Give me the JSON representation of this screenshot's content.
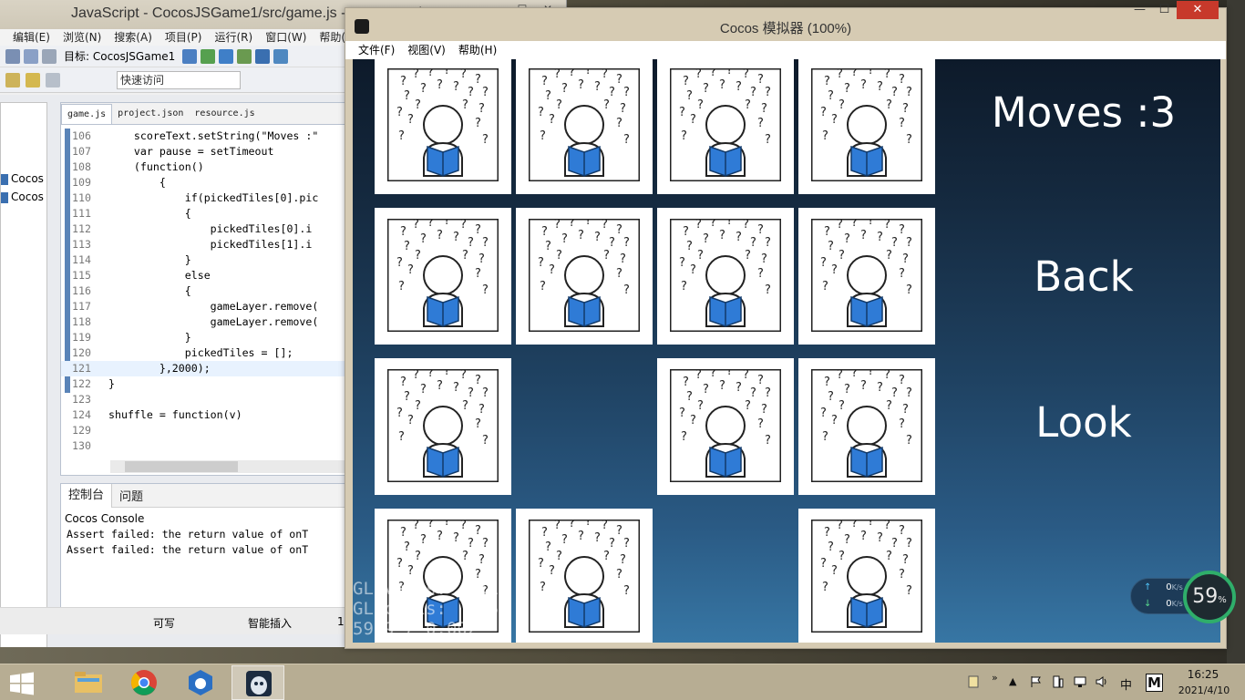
{
  "ide": {
    "title": "JavaScript - CocosJSGame1/src/game.js - Cocos Code IDE",
    "window_buttons": [
      "—",
      "☐",
      "✕"
    ],
    "menu": [
      "编辑(E)",
      "浏览(N)",
      "搜索(A)",
      "项目(P)",
      "运行(R)",
      "窗口(W)",
      "帮助(H)"
    ],
    "target_label": "目标: CocosJSGame1",
    "quick_access_placeholder": "快速访问",
    "explorer_items": [
      "Cocos",
      "Cocos"
    ],
    "editor_tabs": [
      "game.js",
      "project.json",
      "resource.js"
    ],
    "code_lines": [
      {
        "num": "106",
        "text": "    scoreText.setString(\"Moves :\""
      },
      {
        "num": "107",
        "text": "    var pause = setTimeout"
      },
      {
        "num": "108",
        "text": "    (function()"
      },
      {
        "num": "109",
        "text": "        {"
      },
      {
        "num": "110",
        "text": "            if(pickedTiles[0].pic"
      },
      {
        "num": "111",
        "text": "            {"
      },
      {
        "num": "112",
        "text": "                pickedTiles[0].i"
      },
      {
        "num": "113",
        "text": "                pickedTiles[1].i"
      },
      {
        "num": "114",
        "text": "            }"
      },
      {
        "num": "115",
        "text": "            else"
      },
      {
        "num": "116",
        "text": "            {"
      },
      {
        "num": "117",
        "text": "                gameLayer.remove("
      },
      {
        "num": "118",
        "text": "                gameLayer.remove("
      },
      {
        "num": "119",
        "text": "            }"
      },
      {
        "num": "120",
        "text": "            pickedTiles = [];"
      },
      {
        "num": "121",
        "text": "        },2000);"
      },
      {
        "num": "122",
        "text": "}"
      },
      {
        "num": "123",
        "text": ""
      },
      {
        "num": "124",
        "text": "shuffle = function(v)"
      },
      {
        "num": "129",
        "text": ""
      },
      {
        "num": "130",
        "text": ""
      }
    ],
    "console_tabs": [
      "控制台",
      "问题"
    ],
    "console_title": "Cocos Console",
    "console_lines": [
      "Assert failed: the return value of onT",
      "Assert failed: the return value of onT"
    ],
    "status": {
      "writable": "可写",
      "insert_mode": "智能插入",
      "position": "1"
    }
  },
  "simulator": {
    "title": "Cocos 模拟器 (100%)",
    "menu": [
      "文件(F)",
      "视图(V)",
      "帮助(H)"
    ],
    "window_buttons": [
      "—",
      "☐",
      "✕"
    ],
    "moves_label": "Moves :3",
    "back_label": "Back",
    "look_label": "Look",
    "tiles_visible": [
      [
        true,
        true,
        true,
        true
      ],
      [
        true,
        true,
        true,
        true
      ],
      [
        true,
        false,
        true,
        true
      ],
      [
        true,
        true,
        false,
        true
      ]
    ],
    "gl_stats": [
      "GL verts:   110",
      "GL calls:    6",
      "59.9 / 0.002"
    ]
  },
  "net_widget": {
    "upload": "0",
    "upload_unit": "K/s",
    "download": "0",
    "download_unit": "K/s",
    "percent": "59",
    "percent_unit": "%"
  },
  "taskbar": {
    "apps": [
      "file-explorer",
      "chrome",
      "cocos-code-ide",
      "cocos-simulator"
    ],
    "ime_label": "中",
    "ime_mode": "M",
    "time": "16:25",
    "date": "2021/4/10"
  }
}
